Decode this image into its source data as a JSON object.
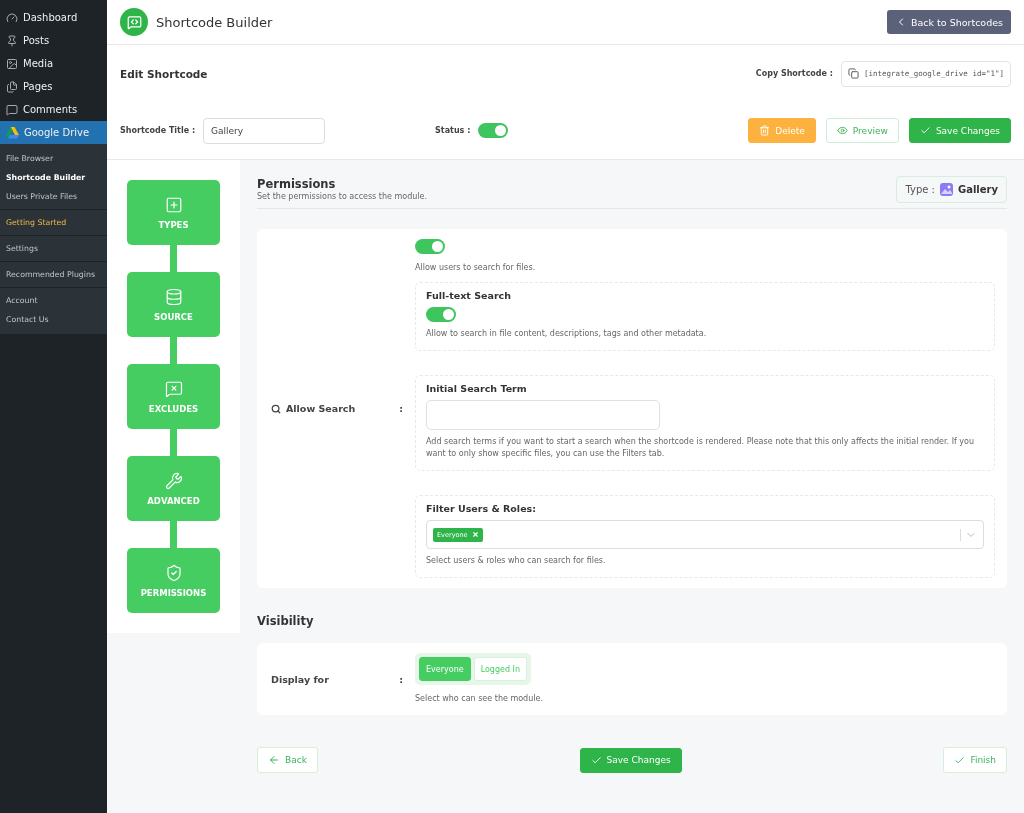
{
  "admin_menu": {
    "items": [
      {
        "label": "Dashboard",
        "kind": "gauge",
        "selected": false
      },
      {
        "label": "Posts",
        "kind": "pin",
        "selected": false
      },
      {
        "label": "Media",
        "kind": "media",
        "selected": false
      },
      {
        "label": "Pages",
        "kind": "pages",
        "selected": false
      },
      {
        "label": "Comments",
        "kind": "comments",
        "selected": false
      },
      {
        "label": "Google Drive",
        "kind": "drive",
        "selected": true
      }
    ],
    "submenu_groups": [
      [
        {
          "label": "File Browser",
          "selected": false,
          "accent": false
        },
        {
          "label": "Shortcode Builder",
          "selected": true,
          "accent": false
        },
        {
          "label": "Users Private Files",
          "selected": false,
          "accent": false
        }
      ],
      [
        {
          "label": "Getting Started",
          "selected": false,
          "accent": true
        }
      ],
      [
        {
          "label": "Settings",
          "selected": false,
          "accent": false
        }
      ],
      [
        {
          "label": "Recommended Plugins",
          "selected": false,
          "accent": false
        }
      ],
      [
        {
          "label": "Account",
          "selected": false,
          "accent": false
        },
        {
          "label": "Contact Us",
          "selected": false,
          "accent": false
        }
      ]
    ]
  },
  "header": {
    "title": "Shortcode Builder",
    "back_button": "Back to Shortcodes"
  },
  "edit": {
    "heading": "Edit Shortcode",
    "copy_label": "Copy Shortcode :",
    "shortcode": "[integrate_google_drive id=\"1\"]",
    "title_label": "Shortcode Title :",
    "title_value": "Gallery",
    "status_label": "Status :",
    "status_on": true,
    "buttons": {
      "delete": "Delete",
      "preview": "Preview",
      "save": "Save Changes"
    }
  },
  "steps": [
    {
      "label": "TYPES",
      "kind": "types"
    },
    {
      "label": "SOURCE",
      "kind": "source"
    },
    {
      "label": "EXCLUDES",
      "kind": "excludes"
    },
    {
      "label": "ADVANCED",
      "kind": "advanced"
    },
    {
      "label": "PERMISSIONS",
      "kind": "permissions"
    }
  ],
  "permissions": {
    "title": "Permissions",
    "subtitle": "Set the permissions to access the module.",
    "type_label": "Type :",
    "type_value": "Gallery",
    "allow_search": {
      "label": "Allow Search",
      "colon": ":",
      "on": true,
      "description": "Allow users to search for files.",
      "full_text": {
        "title": "Full-text Search",
        "on": true,
        "description": "Allow to search in file content, descriptions, tags and other metadata."
      },
      "initial_term": {
        "title": "Initial Search Term",
        "description": "Add search terms if you want to start a search when the shortcode is rendered. Please note that this only affects the initial render. If you want to only show specific files, you can use the Filters tab."
      },
      "filter_roles": {
        "title": "Filter Users & Roles:",
        "tags": [
          "Everyone"
        ],
        "description": "Select users & roles who can search for files."
      }
    }
  },
  "visibility": {
    "title": "Visibility",
    "label": "Display for",
    "colon": ":",
    "options": [
      {
        "label": "Everyone",
        "selected": true
      },
      {
        "label": "Logged In",
        "selected": false
      }
    ],
    "description": "Select who can see the module."
  },
  "footer": {
    "back": "Back",
    "save": "Save Changes",
    "finish": "Finish"
  }
}
